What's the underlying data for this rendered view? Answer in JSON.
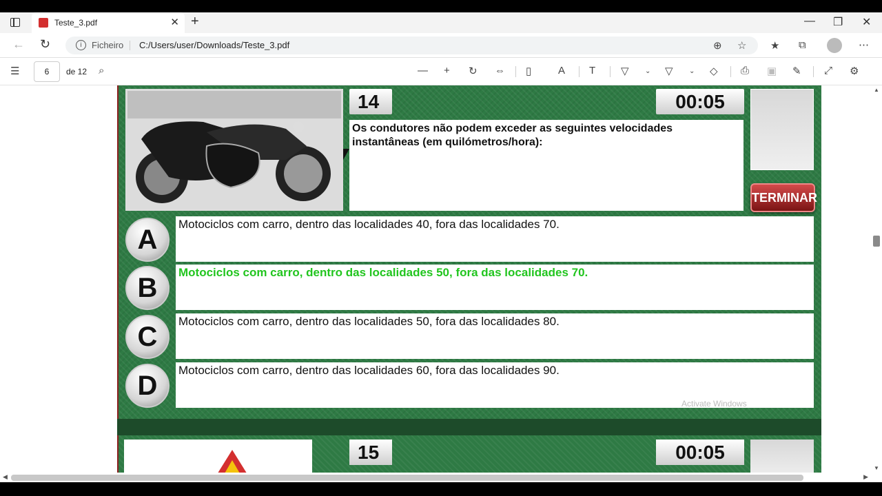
{
  "browser": {
    "tab_title": "Teste_3.pdf",
    "address_label": "Ficheiro",
    "url": "C:/Users/user/Downloads/Teste_3.pdf"
  },
  "pdf_toolbar": {
    "page_current": "6",
    "page_total": "de 12"
  },
  "question": {
    "number": "14",
    "timer": "00:05",
    "text": "Os condutores não podem exceder as seguintes velocidades instantâneas (em quilómetros/hora):",
    "terminate_label": "TERMINAR"
  },
  "options": [
    {
      "letter": "A",
      "text": "Motociclos com carro, dentro das localidades 40, fora das localidades 70."
    },
    {
      "letter": "B",
      "text": "Motociclos com carro, dentro das localidades 50, fora das localidades 70."
    },
    {
      "letter": "C",
      "text": "Motociclos com carro, dentro das localidades 50, fora das localidades 80."
    },
    {
      "letter": "D",
      "text": "Motociclos com carro, dentro das localidades 60, fora das localidades 90."
    }
  ],
  "watermark": "Activate Windows",
  "next_question": {
    "number": "15",
    "timer": "00:05"
  },
  "colors": {
    "background_green": "#2e7a44",
    "correct_answer": "#22c51f",
    "terminate_button": "#b02828"
  }
}
